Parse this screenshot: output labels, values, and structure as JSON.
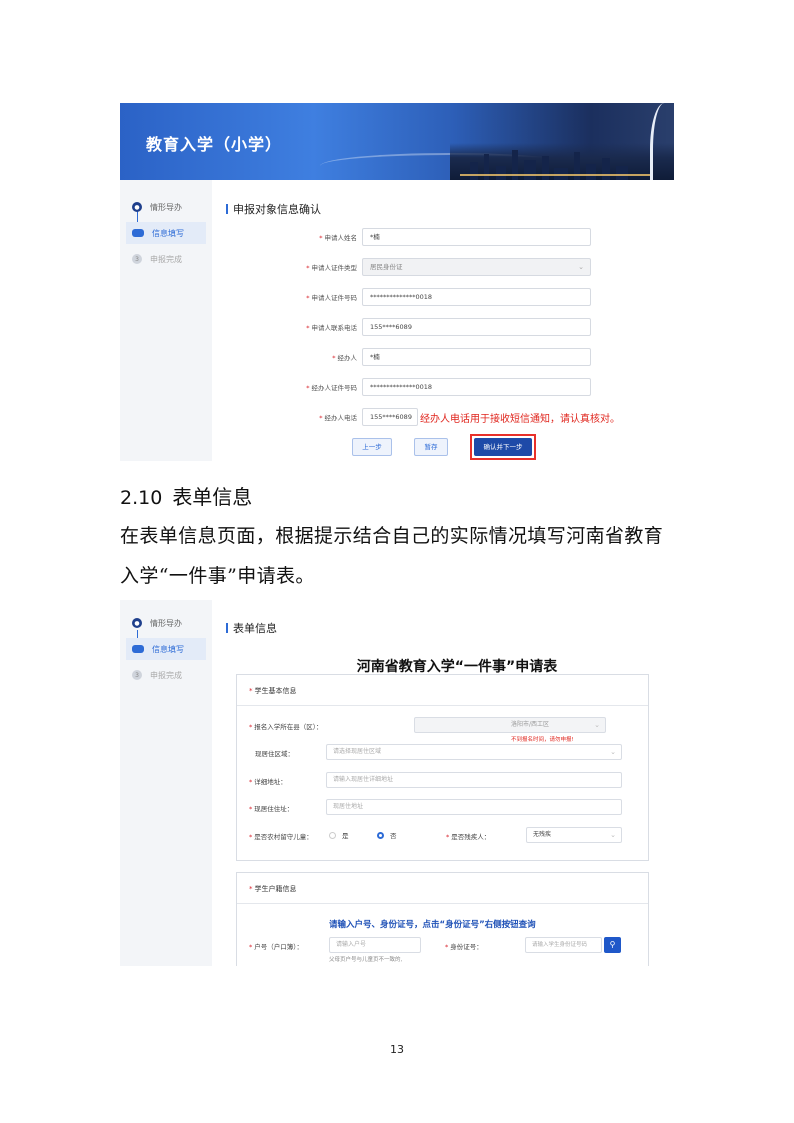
{
  "shot1": {
    "banner_title": "教育入学（小学）",
    "steps": [
      {
        "label": "情形导办",
        "icon": "step-done-icon"
      },
      {
        "label": "信息填写",
        "icon": "step-current-icon"
      },
      {
        "label": "申报完成",
        "icon": "step-wait-icon",
        "num": "3"
      }
    ],
    "section_title": "申报对象信息确认",
    "fields": [
      {
        "label": "申请人姓名",
        "value": "*楠"
      },
      {
        "label": "申请人证件类型",
        "value": "居民身份证"
      },
      {
        "label": "申请人证件号码",
        "value": "**************0018"
      },
      {
        "label": "申请人联系电话",
        "value": "155****6089"
      },
      {
        "label": "经办人",
        "value": "*楠"
      },
      {
        "label": "经办人证件号码",
        "value": "**************0018"
      },
      {
        "label": "经办人电话",
        "value": "155****6089"
      }
    ],
    "phone_note": "经办人电话用于接收短信通知，请认真核对。",
    "buttons": {
      "prev": "上一步",
      "save": "暂存",
      "confirm": "确认并下一步"
    }
  },
  "doc": {
    "heading_num": "2.10",
    "heading_text": "表单信息",
    "paragraph": "在表单信息页面，根据提示结合自己的实际情况填写河南省教育入学“一件事”申请表。"
  },
  "shot2": {
    "steps": [
      {
        "label": "情形导办"
      },
      {
        "label": "信息填写"
      },
      {
        "label": "申报完成",
        "num": "3"
      }
    ],
    "section_title": "表单信息",
    "form_title": "河南省教育入学“一件事”申请表",
    "card1": {
      "title": "学生基本信息",
      "enroll_label": "报名入学所在县（区）：",
      "enroll_value": "洛阳市/西工区",
      "enroll_warning": "不到报名时间，请勿申报!",
      "residence_label": "现居住区域：",
      "residence_placeholder": "请选择现居住区域",
      "address_label": "详细地址：",
      "address_placeholder": "请输入现居住详细地址",
      "current_label": "现居住住址：",
      "current_placeholder": "现居住地址",
      "left_behind_label": "是否农村留守儿童：",
      "yes": "是",
      "no": "否",
      "disabled_label": "是否残疾人：",
      "disabled_value": "无残疾"
    },
    "card2": {
      "title": "学生户籍信息",
      "hint": "请输入户号、身份证号，点击“身份证号”右侧按钮查询",
      "hukou_label": "户号（户口簿）：",
      "hukou_placeholder": "请输入户号",
      "hukou_note": "父母页户号与儿童页不一致的,",
      "id_label": "身份证号：",
      "id_placeholder": "请输入学生身份证号码"
    }
  },
  "page_number": "13"
}
